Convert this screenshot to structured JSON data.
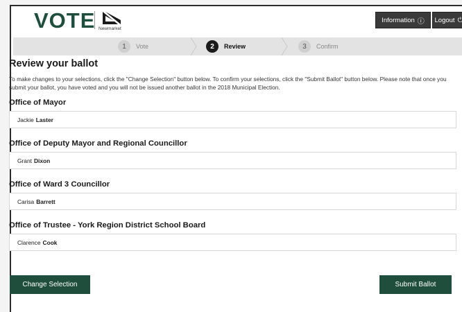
{
  "header": {
    "logo_text": "VOTE",
    "logo_town": "Newmarket",
    "info_label": "Information",
    "info_icon": "info-circle-icon",
    "logout_label": "Logout",
    "logout_icon": "power-icon"
  },
  "steps": [
    {
      "number": "1",
      "label": "Vote",
      "state": "done"
    },
    {
      "number": "2",
      "label": "Review",
      "state": "active"
    },
    {
      "number": "3",
      "label": "Confirm",
      "state": "upcoming"
    }
  ],
  "page": {
    "title": "Review your ballot",
    "intro": "To make changes to your selections, click the \"Change Selection\" button below. To confirm your selections, click the \"Submit Ballot\" button below. Please note that once you submit your ballot, you have voted and you will not be issued another ballot in the 2018 Municipal Election."
  },
  "offices": [
    {
      "title": "Office of Mayor",
      "first": "Jackie",
      "last": "Laster"
    },
    {
      "title": "Office of Deputy Mayor and Regional Councillor",
      "first": "Grant",
      "last": "Dixon"
    },
    {
      "title": "Office of Ward 3 Councillor",
      "first": "Carisa",
      "last": "Barrett"
    },
    {
      "title": "Office of Trustee - York Region District School Board",
      "first": "Clarence",
      "last": "Cook"
    }
  ],
  "actions": {
    "change_label": "Change Selection",
    "submit_label": "Submit Ballot"
  },
  "colors": {
    "brand_green": "#1f4e3d",
    "header_button": "#3a3a3a",
    "stepper_bg": "#e3e3e3"
  }
}
